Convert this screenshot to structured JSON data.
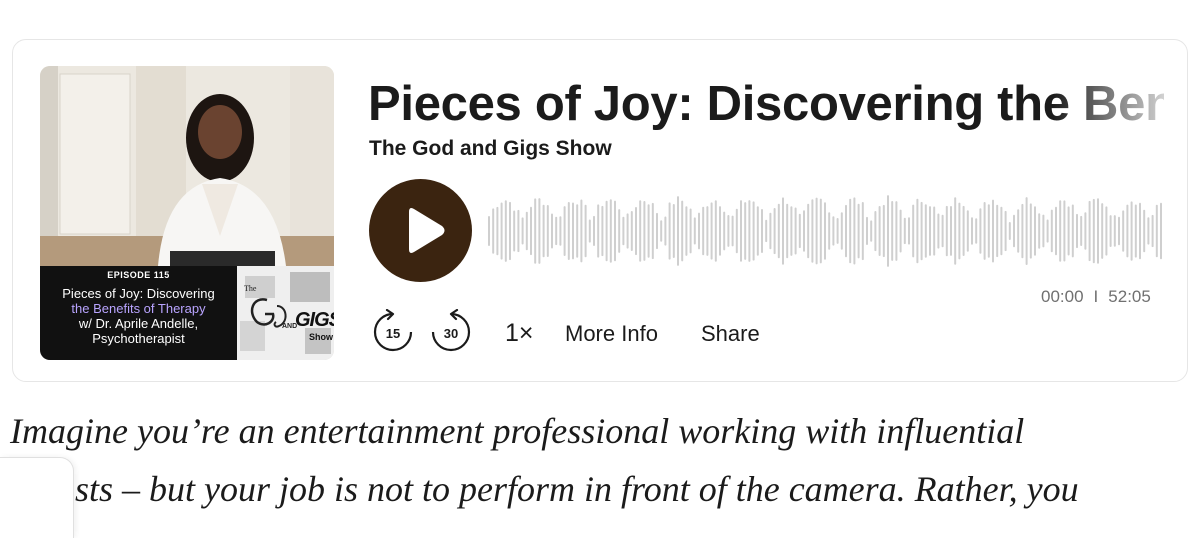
{
  "player": {
    "episode_title": "Pieces of Joy: Discovering the Benefits of Therapy w/ Dr. Aprile Andelle, Psychotherapist",
    "show_name": "The God and Gigs Show",
    "time_current": "00:00",
    "time_separator": "I",
    "time_total": "52:05",
    "skip_back": "15",
    "skip_forward": "30",
    "speed": "1×",
    "more_info": "More Info",
    "share": "Share",
    "play_icon": "play-icon",
    "accent_color": "#3b2410"
  },
  "artwork": {
    "episode_label": "EPISODE 115",
    "line1": "Pieces of Joy: Discovering",
    "line2": "the Benefits of Therapy",
    "line3": "w/ Dr. Aprile Andelle,",
    "line4": "Psychotherapist",
    "logo_the": "The",
    "logo_and": "AND",
    "logo_gigs": "GIGS",
    "logo_show": "Show"
  },
  "article": {
    "line1": "Imagine you’re an entertainment professional working with influential",
    "line2": "sts – but your job is not to perform in front of the camera. Rather, you"
  }
}
